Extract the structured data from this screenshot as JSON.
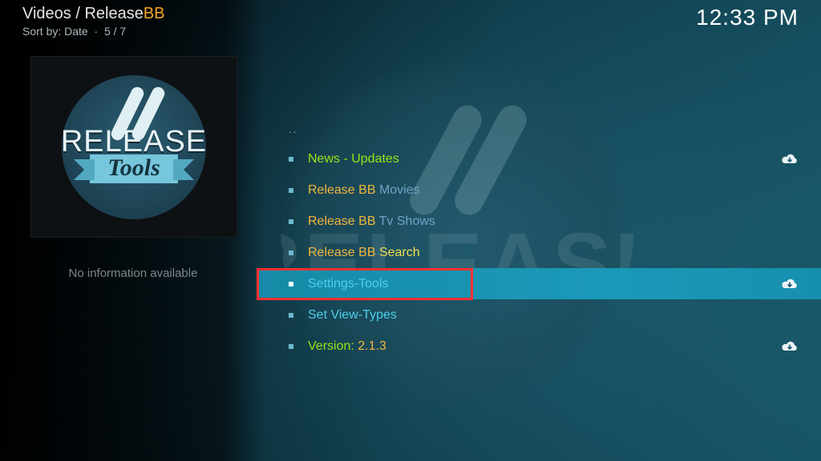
{
  "header": {
    "breadcrumb_prefix": "Videos / Release",
    "breadcrumb_accent": "BB",
    "sort_label": "Sort by: Date",
    "position": "5 / 7",
    "clock": "12:33 PM"
  },
  "sidebar": {
    "logo_release": "RELEASE",
    "logo_ribbon": "Tools",
    "info_text": "No information available"
  },
  "list": {
    "header_dots": "..",
    "items": [
      {
        "parts": [
          {
            "text": "News - Updates",
            "cls": "lime"
          }
        ],
        "cloud": true,
        "focused": false
      },
      {
        "parts": [
          {
            "text": "Release BB ",
            "cls": "gold"
          },
          {
            "text": "Movies",
            "cls": "steel"
          }
        ],
        "cloud": false,
        "focused": false
      },
      {
        "parts": [
          {
            "text": "Release BB ",
            "cls": "gold"
          },
          {
            "text": "Tv Shows",
            "cls": "steel"
          }
        ],
        "cloud": false,
        "focused": false
      },
      {
        "parts": [
          {
            "text": "Release BB ",
            "cls": "gold"
          },
          {
            "text": "Search",
            "cls": "yellow"
          }
        ],
        "cloud": false,
        "focused": false
      },
      {
        "parts": [
          {
            "text": "Settings-Tools",
            "cls": "cyan"
          }
        ],
        "cloud": true,
        "focused": true
      },
      {
        "parts": [
          {
            "text": "Set View-Types",
            "cls": "cyan"
          }
        ],
        "cloud": false,
        "focused": false
      },
      {
        "parts": [
          {
            "text": "Version: ",
            "cls": "lime"
          },
          {
            "text": "2.1.3",
            "cls": "gold"
          }
        ],
        "cloud": true,
        "focused": false
      }
    ]
  }
}
